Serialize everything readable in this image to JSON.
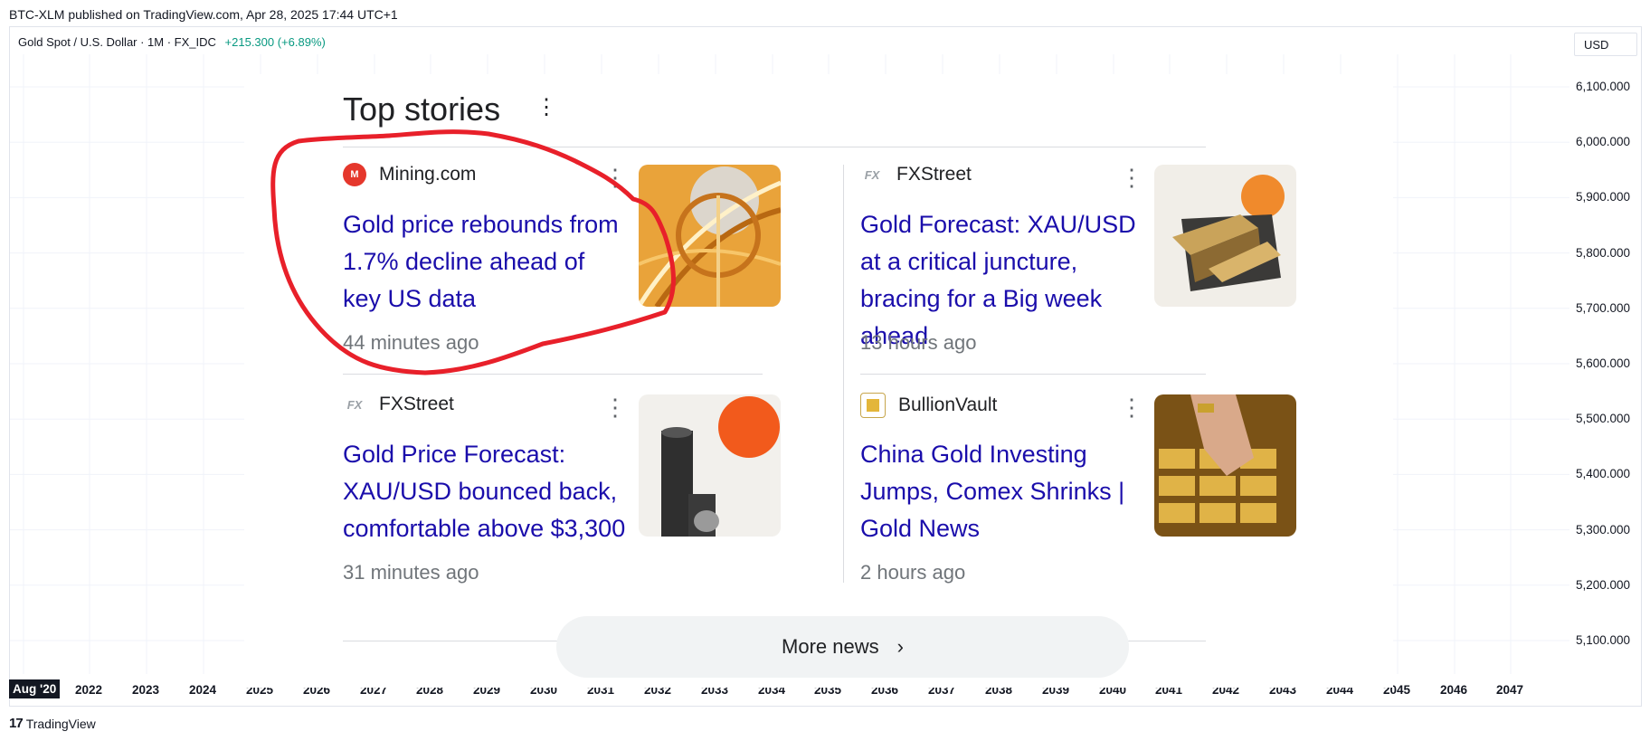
{
  "header": {
    "published": "BTC-XLM published on TradingView.com, Apr 28, 2025 17:44 UTC+1",
    "symbol": "Gold Spot / U.S. Dollar · 1M · FX_IDC",
    "change": "+215.300 (+6.89%)",
    "currency": "USD"
  },
  "price_axis": [
    "6,100.000",
    "6,000.000",
    "5,900.000",
    "5,800.000",
    "5,700.000",
    "5,600.000",
    "5,500.000",
    "5,400.000",
    "5,300.000",
    "5,200.000",
    "5,100.000"
  ],
  "time_axis": [
    "Aug '20",
    "2022",
    "2023",
    "2024",
    "2025",
    "2026",
    "2027",
    "2028",
    "2029",
    "2030",
    "2031",
    "2032",
    "2033",
    "2034",
    "2035",
    "2036",
    "2037",
    "2038",
    "2039",
    "2040",
    "2041",
    "2042",
    "2043",
    "2044",
    "2045",
    "2046",
    "2047"
  ],
  "footer": {
    "brand": "TradingView",
    "logo": "17"
  },
  "top_stories": {
    "title": "Top stories",
    "more_label": "More news",
    "stories": [
      {
        "source": "Mining.com",
        "headline": "Gold price rebounds from 1.7% decline ahead of key US data",
        "time": "44 minutes ago"
      },
      {
        "source": "FXStreet",
        "headline": "Gold Forecast: XAU/USD at a critical juncture, bracing for a Big week ahead",
        "time": "13 hours ago"
      },
      {
        "source": "FXStreet",
        "headline": "Gold Price Forecast: XAU/USD bounced back, comfortable above $3,300",
        "time": "31 minutes ago"
      },
      {
        "source": "BullionVault",
        "headline": "China Gold Investing Jumps, Comex Shrinks | Gold News",
        "time": "2 hours ago"
      }
    ]
  },
  "colors": {
    "accent_green": "#089981",
    "link_blue": "#1a0dab",
    "annotation_red": "#e8202a"
  }
}
